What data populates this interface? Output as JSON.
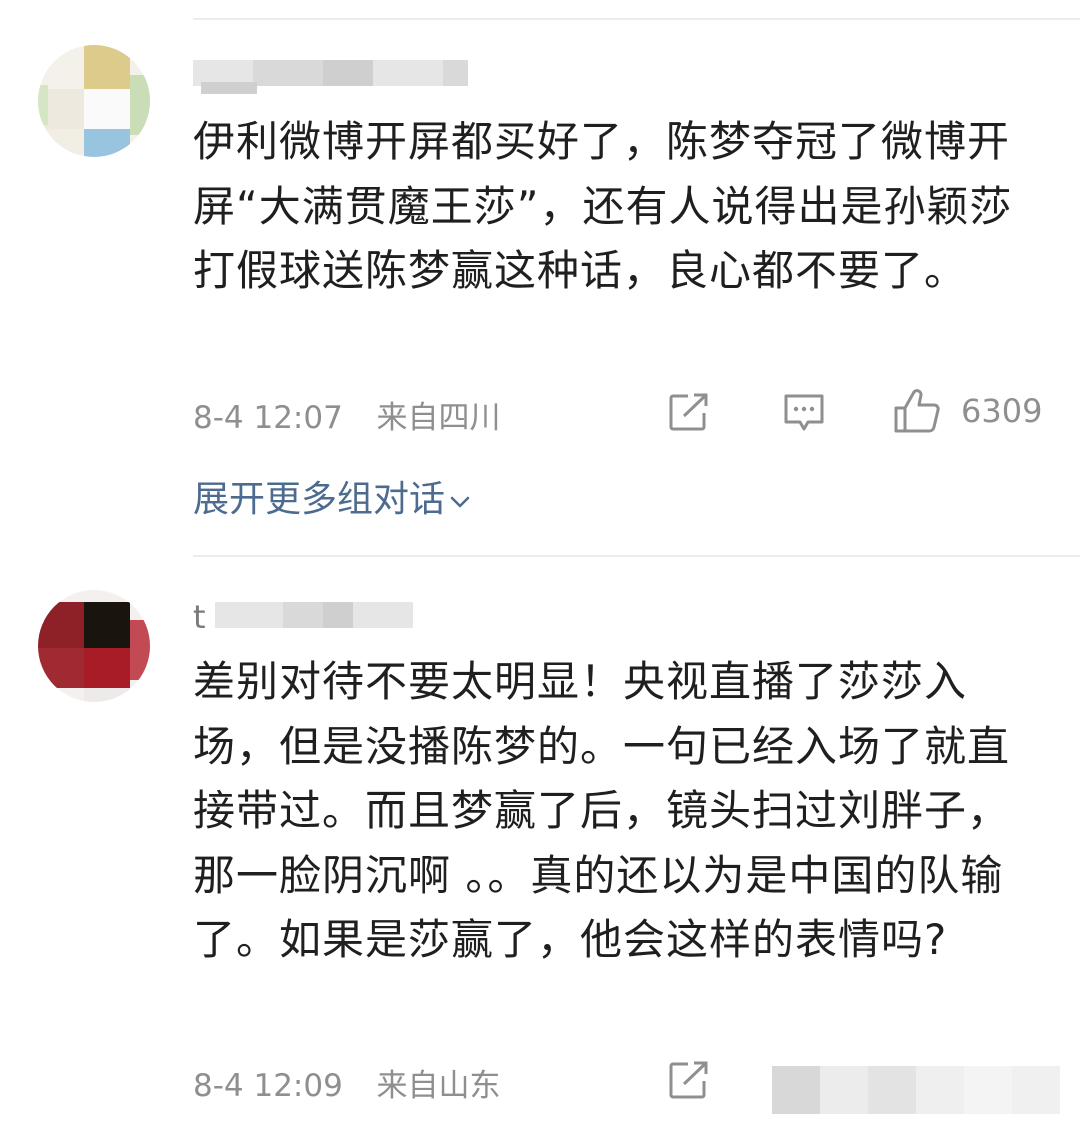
{
  "comments": [
    {
      "username_partial": "",
      "text": "伊利微博开屏都买好了，陈梦夺冠了微博开屏“大满贯魔王莎”，还有人说得出是孙颖莎打假球送陈梦赢这种话，良心都不要了。",
      "date": "8-4 12:07",
      "location": "来自四川",
      "like_count": "6309",
      "expand_label": "展开更多组对话"
    },
    {
      "username_partial": "t",
      "text": "差别对待不要太明显！央视直播了莎莎入场，但是没播陈梦的。一句已经入场了就直接带过。而且梦赢了后，镜头扫过刘胖子，那一脸阴沉啊 。。真的还以为是中国的队输了。如果是莎赢了，他会这样的表情吗?",
      "date": "8-4 12:09",
      "location": "来自山东"
    }
  ],
  "icons": {
    "share": "share-icon",
    "comment": "comment-icon",
    "like": "thumbs-up-icon",
    "expand": "chevron-down-icon"
  },
  "colors": {
    "text": "#1f1f1f",
    "meta": "#8f8f8f",
    "link": "#4c6b8f",
    "divider": "#ececec"
  }
}
